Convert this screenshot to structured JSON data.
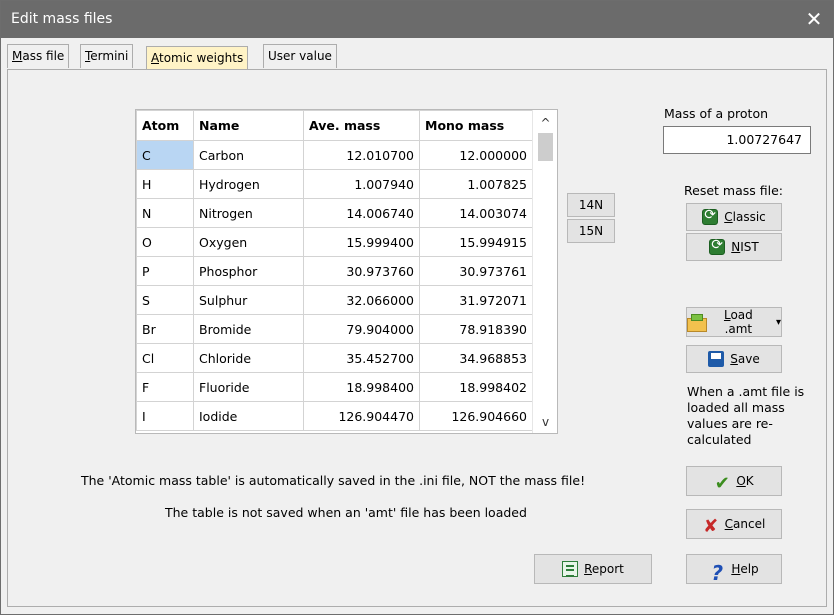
{
  "window": {
    "title": "Edit mass files",
    "close_label": "✕"
  },
  "tabs": [
    {
      "label": "Mass file",
      "underline": "M",
      "rest": "ass file"
    },
    {
      "label": "Termini",
      "underline": "T",
      "rest": "ermini"
    },
    {
      "label": "Atomic weights",
      "underline": "A",
      "rest": "tomic weights"
    },
    {
      "label": "User value",
      "underline": "",
      "rest": "User value"
    }
  ],
  "active_tab": "Atomic weights",
  "table": {
    "columns": [
      "Atom",
      "Name",
      "Ave. mass",
      "Mono mass"
    ],
    "rows": [
      [
        "C",
        "Carbon",
        "12.010700",
        "12.000000"
      ],
      [
        "H",
        "Hydrogen",
        "1.007940",
        "1.007825"
      ],
      [
        "N",
        "Nitrogen",
        "14.006740",
        "14.003074"
      ],
      [
        "O",
        "Oxygen",
        "15.999400",
        "15.994915"
      ],
      [
        "P",
        "Phosphor",
        "30.973760",
        "30.973761"
      ],
      [
        "S",
        "Sulphur",
        "32.066000",
        "31.972071"
      ],
      [
        "Br",
        "Bromide",
        "79.904000",
        "78.918390"
      ],
      [
        "Cl",
        "Chloride",
        "35.452700",
        "34.968853"
      ],
      [
        "F",
        "Fluoride",
        "18.998400",
        "18.998402"
      ],
      [
        "I",
        "Iodide",
        "126.904470",
        "126.904660"
      ]
    ],
    "selected_row": 0,
    "scroll_up": "^",
    "scroll_down": "v"
  },
  "isotope_buttons": {
    "n14": "14N",
    "n15": "15N"
  },
  "proton": {
    "label": "Mass of a proton",
    "value": "1.00727647"
  },
  "reset": {
    "label": "Reset mass file:",
    "classic": {
      "underline": "C",
      "rest": "lassic"
    },
    "nist": {
      "underline": "N",
      "rest": "IST"
    }
  },
  "load_amt": {
    "underline": "L",
    "rest": "oad .amt",
    "arrow": "▾"
  },
  "save": {
    "underline": "S",
    "rest": "ave"
  },
  "amt_note": "When a .amt file is loaded all mass values are re-calculated",
  "info_line1": "The 'Atomic mass table' is automatically saved in the .ini file, NOT the mass file!",
  "info_line2": "The table is not saved when an 'amt' file has been loaded",
  "buttons": {
    "ok": {
      "underline": "O",
      "rest": "K"
    },
    "cancel": {
      "underline": "C",
      "rest": "ancel"
    },
    "report": {
      "underline": "R",
      "rest": "eport"
    },
    "help": {
      "underline": "H",
      "rest": "elp"
    }
  },
  "icons": {
    "ok": "✔",
    "cancel": "✘",
    "help": "?"
  }
}
